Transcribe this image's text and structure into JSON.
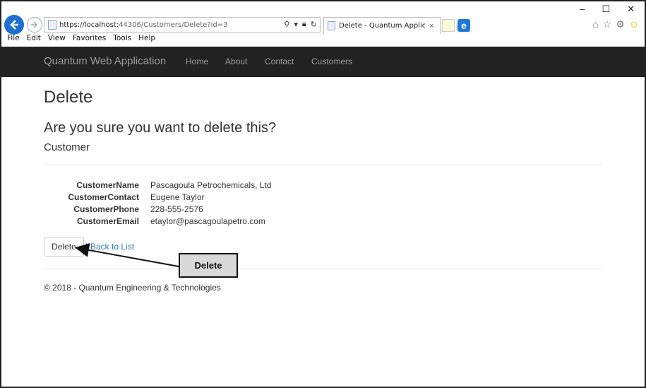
{
  "browser": {
    "url_host": "https://localhost:",
    "url_rest": "44306/Customers/Delete?id=3",
    "tab_title": "Delete - Quantum Applicati",
    "tab_close": "×",
    "ie_glyph": "e",
    "menu": [
      "File",
      "Edit",
      "View",
      "Favorites",
      "Tools",
      "Help"
    ],
    "window_buttons": [
      "–",
      "☐",
      "✕"
    ]
  },
  "navbar": {
    "brand": "Quantum Web Application",
    "links": [
      "Home",
      "About",
      "Contact",
      "Customers"
    ]
  },
  "page": {
    "title": "Delete",
    "confirm": "Are you sure you want to delete this?",
    "entity": "Customer",
    "fields": [
      {
        "label": "CustomerName",
        "value": "Pascagoula Petrochemicals, Ltd"
      },
      {
        "label": "CustomerContact",
        "value": "Eugene Taylor"
      },
      {
        "label": "CustomerPhone",
        "value": "228-555-2576"
      },
      {
        "label": "CustomerEmail",
        "value": "etaylor@pascagoulapetro.com"
      }
    ],
    "delete_label": "Delete",
    "separator": "|",
    "back_label": "Back to List",
    "footer": "© 2018 - Quantum Engineering & Technologies"
  },
  "annotation": {
    "callout_text": "Delete"
  },
  "colors": {
    "navbar_bg": "#222222",
    "nav_text": "#9d9d9d",
    "link": "#337ab7",
    "ie_blue": "#1e6fd0"
  }
}
